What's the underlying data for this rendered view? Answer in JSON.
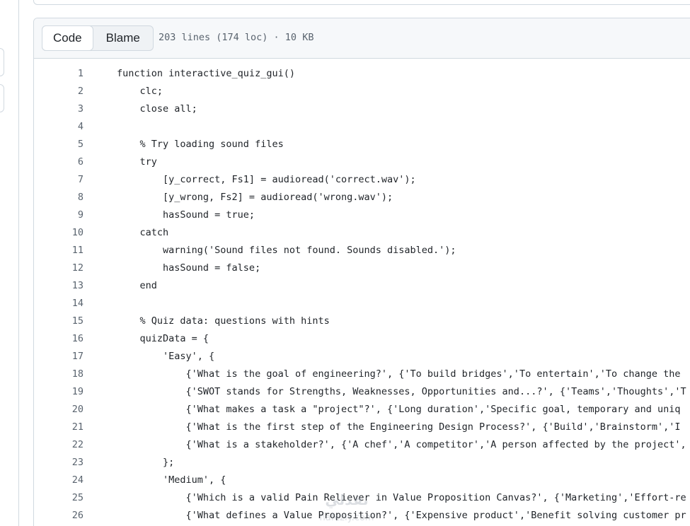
{
  "tabs": {
    "code_label": "Code",
    "blame_label": "Blame"
  },
  "file_meta": "203 lines (174 loc) · 10 KB",
  "code_lines": [
    {
      "num": "1",
      "text": "function interactive_quiz_gui()"
    },
    {
      "num": "2",
      "text": "    clc;"
    },
    {
      "num": "3",
      "text": "    close all;"
    },
    {
      "num": "4",
      "text": ""
    },
    {
      "num": "5",
      "text": "    % Try loading sound files"
    },
    {
      "num": "6",
      "text": "    try"
    },
    {
      "num": "7",
      "text": "        [y_correct, Fs1] = audioread('correct.wav');"
    },
    {
      "num": "8",
      "text": "        [y_wrong, Fs2] = audioread('wrong.wav');"
    },
    {
      "num": "9",
      "text": "        hasSound = true;"
    },
    {
      "num": "10",
      "text": "    catch"
    },
    {
      "num": "11",
      "text": "        warning('Sound files not found. Sounds disabled.');"
    },
    {
      "num": "12",
      "text": "        hasSound = false;"
    },
    {
      "num": "13",
      "text": "    end"
    },
    {
      "num": "14",
      "text": ""
    },
    {
      "num": "15",
      "text": "    % Quiz data: questions with hints"
    },
    {
      "num": "16",
      "text": "    quizData = {"
    },
    {
      "num": "17",
      "text": "        'Easy', {"
    },
    {
      "num": "18",
      "text": "            {'What is the goal of engineering?', {'To build bridges','To entertain','To change the"
    },
    {
      "num": "19",
      "text": "            {'SWOT stands for Strengths, Weaknesses, Opportunities and...?', {'Teams','Thoughts','T"
    },
    {
      "num": "20",
      "text": "            {'What makes a task a \"project\"?', {'Long duration','Specific goal, temporary and uniq"
    },
    {
      "num": "21",
      "text": "            {'What is the first step of the Engineering Design Process?', {'Build','Brainstorm','I"
    },
    {
      "num": "22",
      "text": "            {'What is a stakeholder?', {'A chef','A competitor','A person affected by the project',"
    },
    {
      "num": "23",
      "text": "        };"
    },
    {
      "num": "24",
      "text": "        'Medium', {"
    },
    {
      "num": "25",
      "text": "            {'Which is a valid Pain Reliever in Value Proposition Canvas?', {'Marketing','Effort-re"
    },
    {
      "num": "26",
      "text": "            {'What defines a Value Proposition?', {'Expensive product','Benefit solving customer pr"
    }
  ],
  "colors": {
    "border": "#d1d9e0",
    "header_bg": "#f6f8fa",
    "text": "#1f2328",
    "muted": "#59636e"
  }
}
